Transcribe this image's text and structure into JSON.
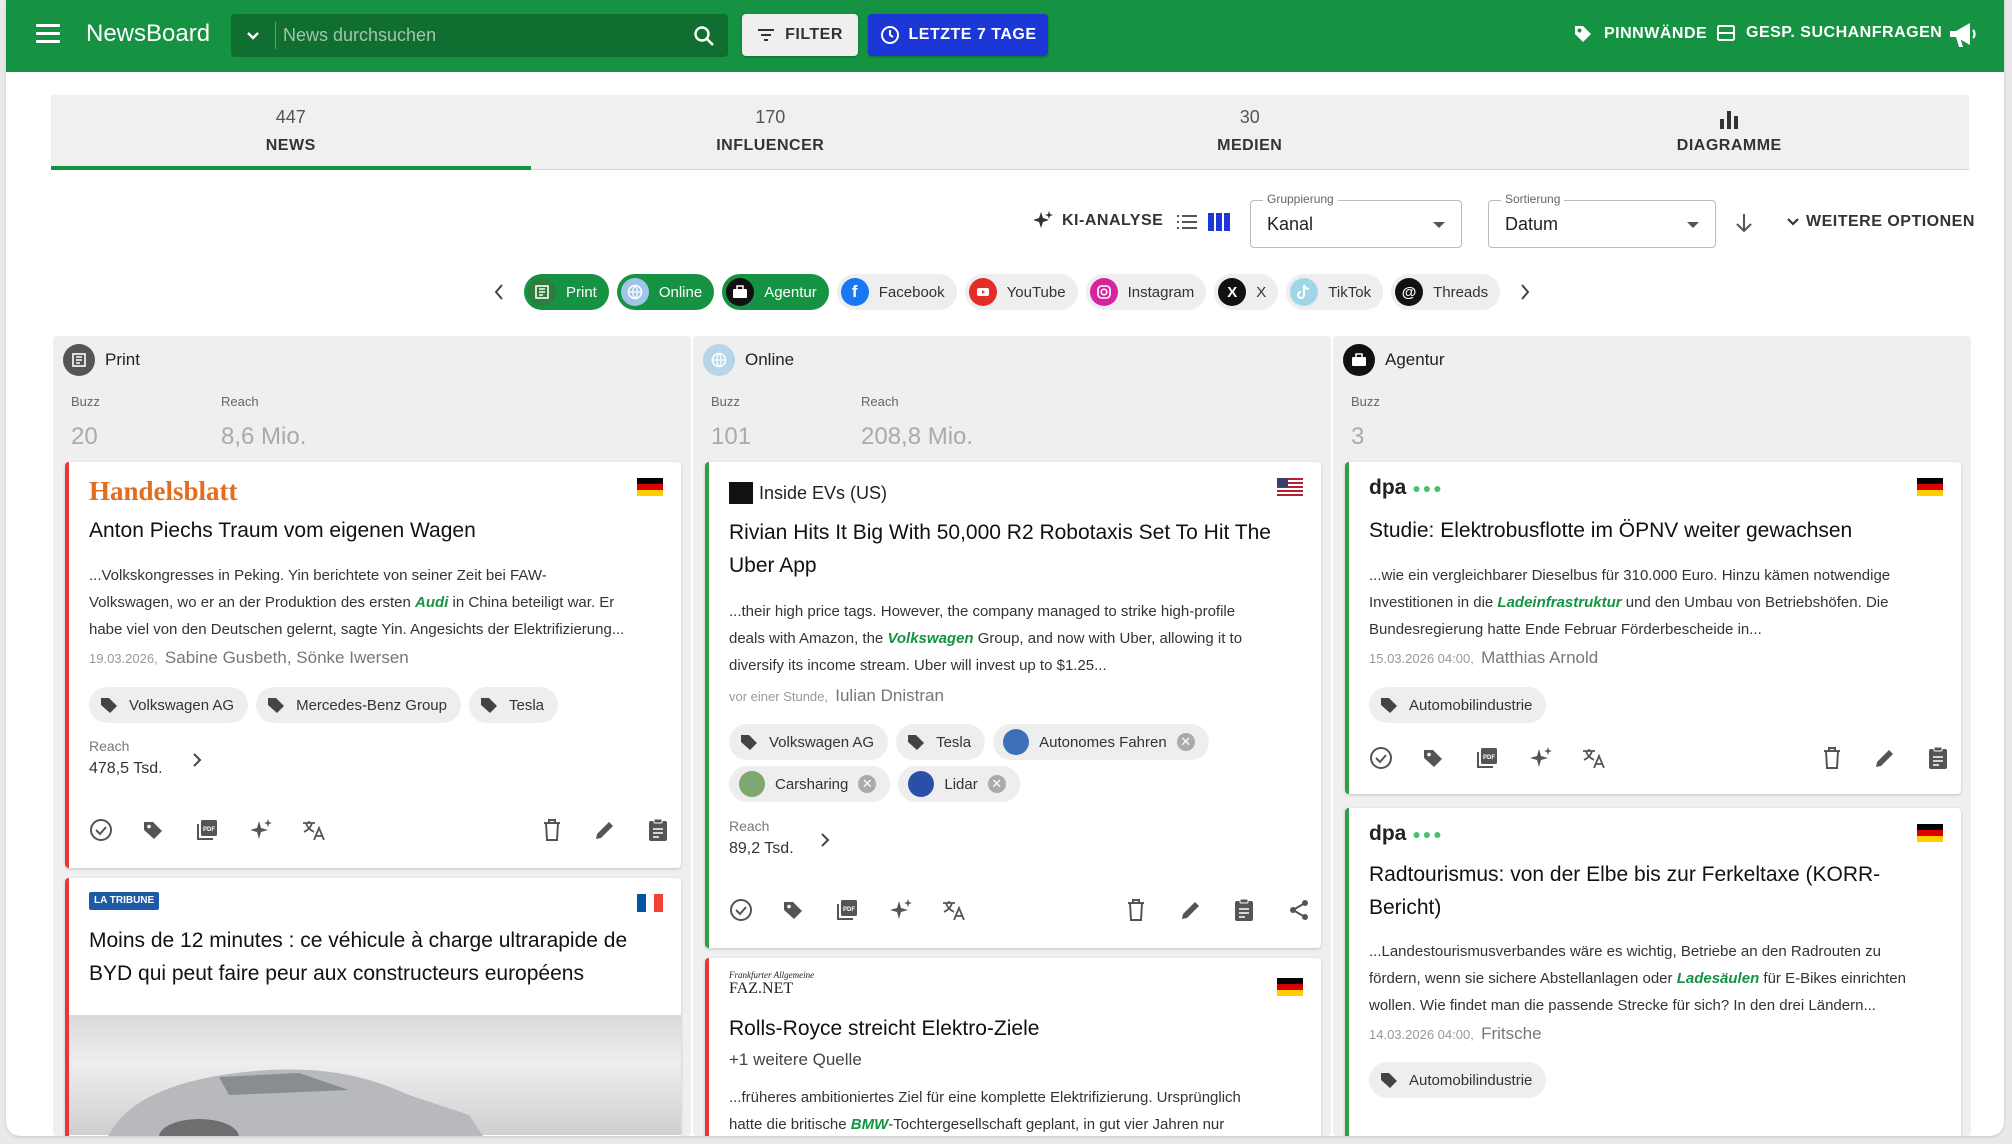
{
  "app": {
    "title": "NewsBoard"
  },
  "search": {
    "placeholder": "News durchsuchen"
  },
  "toolbar": {
    "filter_label": "FILTER",
    "period_label": "LETZTE 7 TAGE",
    "boards_label": "PINNWÄNDE",
    "saved_label": "GESP. SUCHANFRAGEN"
  },
  "tabs": [
    {
      "count": "447",
      "label": "NEWS",
      "active": true
    },
    {
      "count": "170",
      "label": "INFLUENCER"
    },
    {
      "count": "30",
      "label": "MEDIEN"
    },
    {
      "count": "",
      "label": "DIAGRAMME",
      "icon": "bar-chart-icon"
    }
  ],
  "controls": {
    "ai_label": "KI-ANALYSE",
    "grouping": {
      "label": "Gruppierung",
      "value": "Kanal"
    },
    "sorting": {
      "label": "Sortierung",
      "value": "Datum"
    },
    "more_label": "WEITERE OPTIONEN"
  },
  "channels": [
    {
      "label": "Print",
      "selected": true,
      "icon": "newspaper-icon"
    },
    {
      "label": "Online",
      "selected": true,
      "icon": "globe-icon"
    },
    {
      "label": "Agentur",
      "selected": true,
      "icon": "briefcase-icon"
    },
    {
      "label": "Facebook",
      "icon": "facebook-icon"
    },
    {
      "label": "YouTube",
      "icon": "youtube-icon"
    },
    {
      "label": "Instagram",
      "icon": "instagram-icon"
    },
    {
      "label": "X",
      "icon": "x-icon"
    },
    {
      "label": "TikTok",
      "icon": "tiktok-icon"
    },
    {
      "label": "Threads",
      "icon": "threads-icon"
    }
  ],
  "columns": {
    "print": {
      "name": "Print",
      "buzz_label": "Buzz",
      "buzz": "20",
      "reach_label": "Reach",
      "reach": "8,6 Mio.",
      "card1": {
        "source": "Handelsblatt",
        "title": "Anton Piechs Traum vom eigenen Wagen",
        "ex1": "...Volkskongresses in Peking. Yin berichtete von seiner Zeit bei FAW-",
        "ex2a": "Volkswagen, wo er an der Produktion des ersten ",
        "ex2hl": "Audi",
        "ex2b": " in China beteiligt war. Er",
        "ex3": "habe viel von den Deutschen gelernt, sagte Yin. Angesichts der Elektrifizierung...",
        "date": "19.03.2026",
        "authors": "Sabine Gusbeth, Sönke Iwersen",
        "tags": [
          "Volkswagen AG",
          "Mercedes-Benz Group",
          "Tesla"
        ],
        "reach_label": "Reach",
        "reach": "478,5 Tsd."
      },
      "card2": {
        "source": "LA TRIBUNE",
        "title1": "Moins de 12 minutes : ce véhicule à charge ultrarapide de",
        "title2": "BYD qui peut faire peur aux constructeurs européens"
      }
    },
    "online": {
      "name": "Online",
      "buzz_label": "Buzz",
      "buzz": "101",
      "reach_label": "Reach",
      "reach": "208,8 Mio.",
      "card1": {
        "source": "Inside EVs (US)",
        "title1": "Rivian Hits It Big With 50,000 R2 Robotaxis Set To Hit The",
        "title2": "Uber App",
        "ex1": "...their high price tags. However, the company managed to strike high-profile",
        "ex2a": "deals with Amazon, the ",
        "ex2hl": "Volkswagen",
        "ex2b": " Group, and now with Uber, allowing it to",
        "ex3": "diversify its income stream. Uber will invest up to $1.25...",
        "date": "vor einer Stunde",
        "authors": "Iulian Dnistran",
        "tags": [
          "Volkswagen AG",
          "Tesla",
          "Autonomes Fahren",
          "Carsharing",
          "Lidar"
        ],
        "reach_label": "Reach",
        "reach": "89,2 Tsd."
      },
      "card2": {
        "source": "FAZ.NET",
        "source_top": "Frankfurter Allgemeine",
        "title": "Rolls-Royce streicht Elektro-Ziele",
        "more": "+1 weitere Quelle",
        "ex1": "...früheres ambitioniertes Ziel für eine komplette Elektrifizierung. Ursprünglich",
        "ex2a": "hatte die britische ",
        "ex2hl": "BMW",
        "ex2b": "-Tochtergesellschaft geplant, in gut vier Jahren nur"
      }
    },
    "agentur": {
      "name": "Agentur",
      "buzz_label": "Buzz",
      "buzz": "3",
      "card1": {
        "source": "dpa",
        "title": "Studie: Elektrobusflotte im ÖPNV weiter gewachsen",
        "ex1": "...wie ein vergleichbarer Dieselbus für 310.000 Euro. Hinzu kämen notwendige",
        "ex2a": "Investitionen in die ",
        "ex2hl": "Ladeinfrastruktur",
        "ex2b": " und den Umbau von Betriebshöfen. Die",
        "ex3": "Bundesregierung hatte Ende Februar Förderbescheide in...",
        "date": "15.03.2026 04:00",
        "authors": "Matthias Arnold",
        "tags": [
          "Automobilindustrie"
        ]
      },
      "card2": {
        "source": "dpa",
        "title1": "Radtourismus: von der Elbe bis zur Ferkeltaxe (KORR-",
        "title2": "Bericht)",
        "ex1": "...Landestourismusverbandes wäre es wichtig, Betriebe an den Radrouten zu",
        "ex2a": "fördern, wenn sie sichere Abstellanlagen oder ",
        "ex2hl": "Ladesäulen",
        "ex2b": " für E-Bikes einrichten",
        "ex3": "wollen. Wie findet man die passende Strecke für sich? In den drei Ländern...",
        "date": "14.03.2026 04:00",
        "authors": "Fritsche",
        "tags": [
          "Automobilindustrie"
        ]
      }
    }
  },
  "colors": {
    "brand": "#159343",
    "accent_blue": "#1d36d6",
    "print_border": "#e53935",
    "green_border": "#2e9e47"
  }
}
